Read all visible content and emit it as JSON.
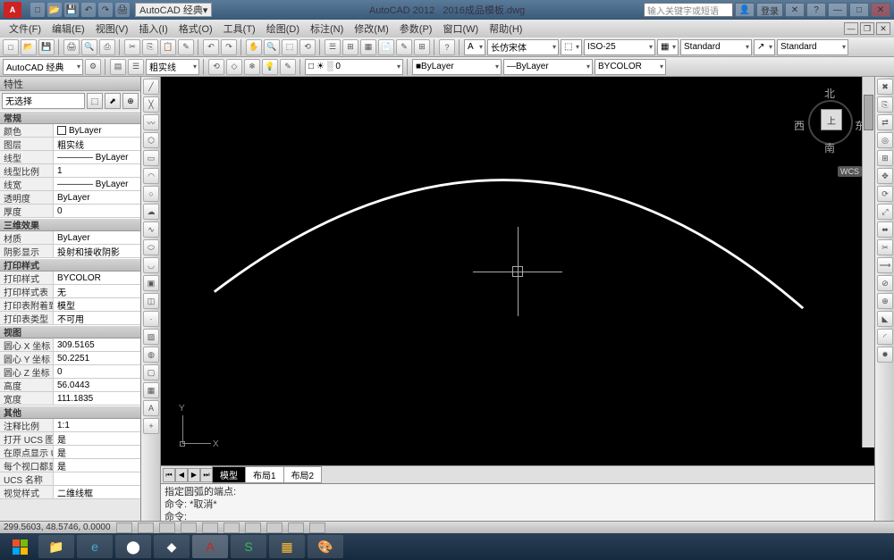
{
  "app": {
    "name": "AutoCAD 2012",
    "document": "2016成品模板.dwg",
    "workspace": "AutoCAD 经典",
    "workspace2": "AutoCAD 经典",
    "search_placeholder": "输入关键字或短语",
    "login": "登录"
  },
  "menu": {
    "items": [
      "文件(F)",
      "编辑(E)",
      "视图(V)",
      "插入(I)",
      "格式(O)",
      "工具(T)",
      "绘图(D)",
      "标注(N)",
      "修改(M)",
      "参数(P)",
      "窗口(W)",
      "帮助(H)"
    ]
  },
  "toolbar2": {
    "layer_dd": "□ ☀ ░ 0",
    "linetype_dd": "粗实线",
    "lineweight_dd": "ByLayer",
    "bylayer_text_dd": "ByLayer",
    "bycolor_dd": "BYCOLOR",
    "textstyle_dd": "长仿宋体",
    "dimstyle_dd": "ISO-25",
    "standard_dd": "Standard",
    "standard2_dd": "Standard"
  },
  "panel": {
    "title": "特性",
    "selection": "无选择",
    "sections": [
      {
        "header": "常规",
        "rows": [
          {
            "k": "颜色",
            "v": "ByLayer",
            "swatch": true
          },
          {
            "k": "图层",
            "v": "粗实线"
          },
          {
            "k": "线型",
            "v": "———— ByLayer"
          },
          {
            "k": "线型比例",
            "v": "1"
          },
          {
            "k": "线宽",
            "v": "———— ByLayer"
          },
          {
            "k": "透明度",
            "v": "ByLayer"
          },
          {
            "k": "厚度",
            "v": "0"
          }
        ]
      },
      {
        "header": "三维效果",
        "rows": [
          {
            "k": "材质",
            "v": "ByLayer"
          },
          {
            "k": "阴影显示",
            "v": "投射和接收阴影"
          }
        ]
      },
      {
        "header": "打印样式",
        "rows": [
          {
            "k": "打印样式",
            "v": "BYCOLOR"
          },
          {
            "k": "打印样式表",
            "v": "无"
          },
          {
            "k": "打印表附着到",
            "v": "模型"
          },
          {
            "k": "打印表类型",
            "v": "不可用"
          }
        ]
      },
      {
        "header": "视图",
        "rows": [
          {
            "k": "圆心 X 坐标",
            "v": "309.5165"
          },
          {
            "k": "圆心 Y 坐标",
            "v": "50.2251"
          },
          {
            "k": "圆心 Z 坐标",
            "v": "0"
          },
          {
            "k": "高度",
            "v": "56.0443"
          },
          {
            "k": "宽度",
            "v": "111.1835"
          }
        ]
      },
      {
        "header": "其他",
        "rows": [
          {
            "k": "注释比例",
            "v": "1:1"
          },
          {
            "k": "打开 UCS 图标",
            "v": "是"
          },
          {
            "k": "在原点显示 U..",
            "v": "是"
          },
          {
            "k": "每个视口都显..",
            "v": "是"
          },
          {
            "k": "UCS 名称",
            "v": ""
          },
          {
            "k": "视觉样式",
            "v": "二维线框"
          }
        ]
      }
    ]
  },
  "viewcube": {
    "n": "北",
    "s": "南",
    "e": "东",
    "w": "西",
    "top": "上",
    "wcs": "WCS"
  },
  "ucs": {
    "x": "X",
    "y": "Y"
  },
  "tabs": {
    "model": "模型",
    "layout1": "布局1",
    "layout2": "布局2"
  },
  "cmd": {
    "line1": "指定圆弧的端点:",
    "line2": "命令: *取消*",
    "line3": "命令:"
  },
  "status": {
    "coords": "299.5603, 48.5746, 0.0000"
  }
}
